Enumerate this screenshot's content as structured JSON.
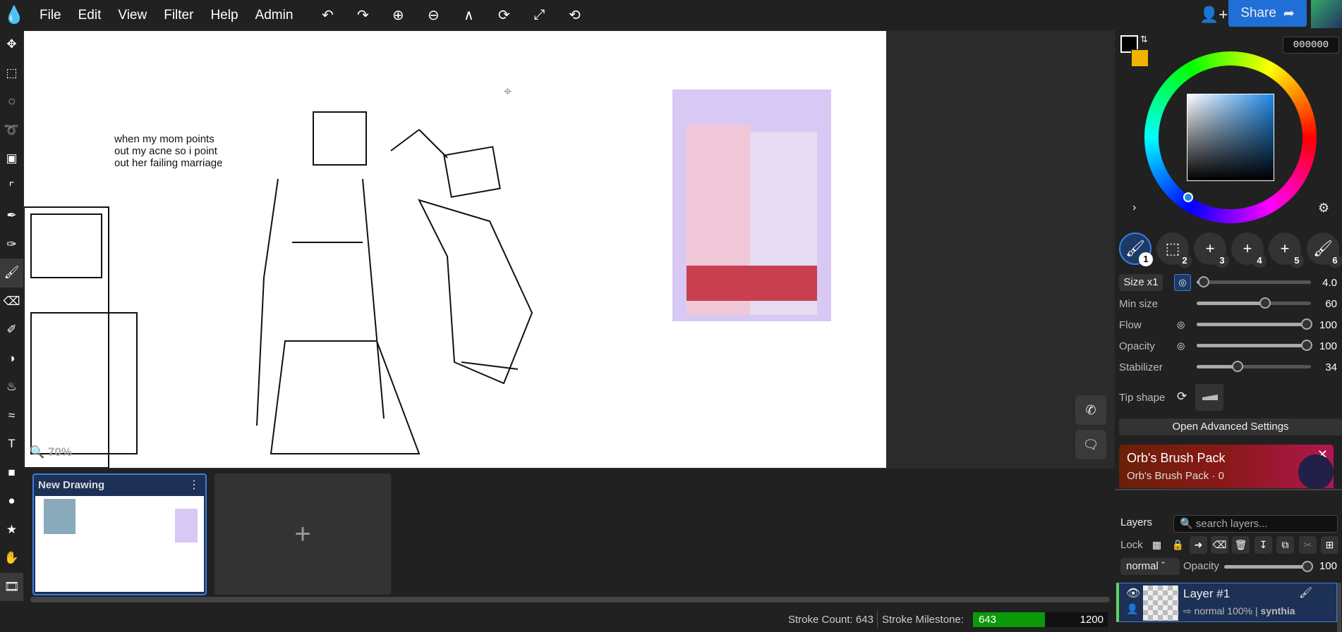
{
  "menu": [
    "File",
    "Edit",
    "View",
    "Filter",
    "Help",
    "Admin"
  ],
  "toolbar_icons": [
    "undo-icon",
    "redo-icon",
    "zoom-in-icon",
    "zoom-out-icon",
    "flip-icon",
    "rotate-icon",
    "fullscreen-icon",
    "reset-rotate-icon"
  ],
  "share_label": "Share",
  "canvas": {
    "caption": [
      "when my mom points",
      "out my acne so i point",
      "out her failing marriage"
    ],
    "zoom": "70%"
  },
  "color": {
    "hex": "000000",
    "primary": "#000000",
    "secondary": "#f0b400"
  },
  "brush_slots": [
    "1",
    "2",
    "3",
    "4",
    "5",
    "6"
  ],
  "brush": {
    "size_label": "Size x1",
    "size": "4.0",
    "size_frac": 0.04,
    "rows": [
      {
        "label": "Min size",
        "value": "60",
        "frac": 0.6
      },
      {
        "label": "Flow",
        "value": "100",
        "frac": 1
      },
      {
        "label": "Opacity",
        "value": "100",
        "frac": 1
      },
      {
        "label": "Stabilizer",
        "value": "34",
        "frac": 0.34
      }
    ],
    "tip_label": "Tip shape",
    "advanced": "Open Advanced Settings"
  },
  "promo": {
    "title": "Orb's Brush Pack",
    "subtitle": "Orb's Brush Pack · 0"
  },
  "layers": {
    "title": "Layers",
    "search_placeholder": "search layers...",
    "lock": "Lock",
    "blend": "normal",
    "opacity_label": "Opacity",
    "opacity": "100",
    "items": [
      {
        "name": "Layer #1",
        "meta": "normal 100% |",
        "owner": "synthia"
      }
    ]
  },
  "drawings": [
    {
      "title": "New Drawing"
    }
  ],
  "status": {
    "stroke_count": "Stroke Count: 643",
    "milestone_label": "Stroke Milestone:",
    "current": "643",
    "target": "1200",
    "progress": 0.536
  }
}
